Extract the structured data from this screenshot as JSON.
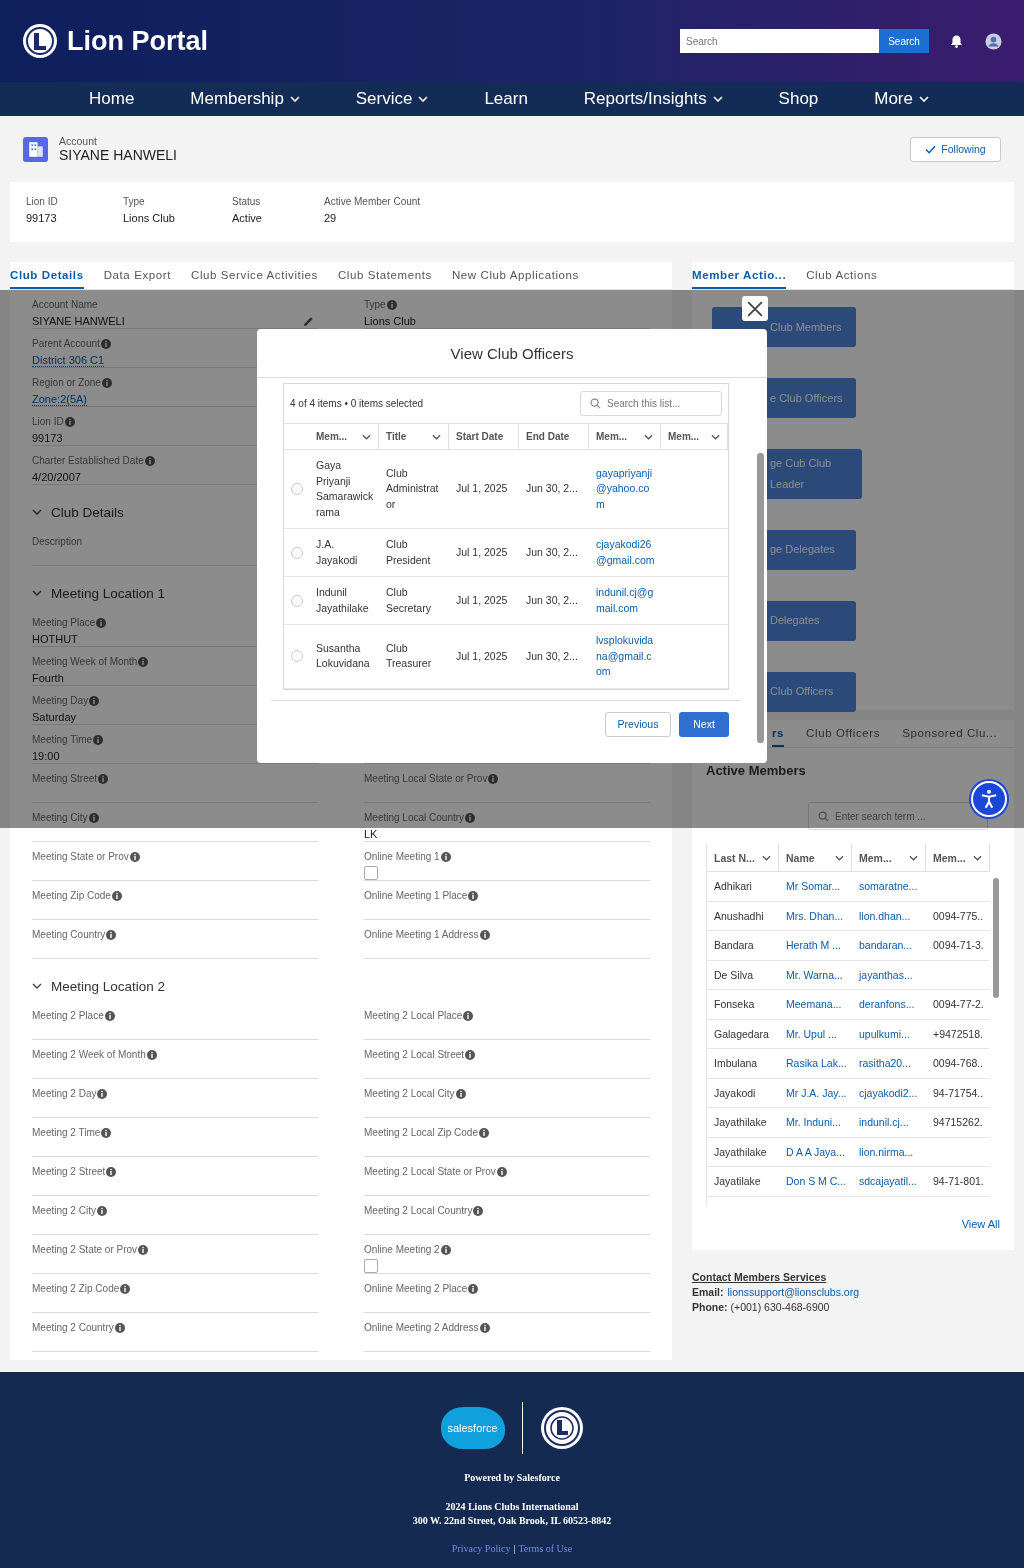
{
  "header": {
    "title": "Lion Portal",
    "search": {
      "placeholder": "Search",
      "button": "Search"
    }
  },
  "nav": [
    {
      "label": "Home",
      "menu": false
    },
    {
      "label": "Membership",
      "menu": true
    },
    {
      "label": "Service",
      "menu": true
    },
    {
      "label": "Learn",
      "menu": false
    },
    {
      "label": "Reports/Insights",
      "menu": true
    },
    {
      "label": "Shop",
      "menu": false
    },
    {
      "label": "More",
      "menu": true
    }
  ],
  "account": {
    "type": "Account",
    "name": "SIYANE HANWELI",
    "follow_button": "Following",
    "following": true
  },
  "highlights": [
    {
      "label": "Lion ID",
      "value": "99173"
    },
    {
      "label": "Type",
      "value": "Lions Club"
    },
    {
      "label": "Status",
      "value": "Active"
    },
    {
      "label": "Active Member Count",
      "value": "29"
    }
  ],
  "details": {
    "tabs": [
      {
        "label": "Club Details",
        "selected": true
      },
      {
        "label": "Data Export",
        "selected": false
      },
      {
        "label": "Club Service Activities",
        "selected": false
      },
      {
        "label": "Club Statements",
        "selected": false
      },
      {
        "label": "New Club Applications",
        "selected": false
      }
    ],
    "sections": [
      {
        "rows": [
          {
            "left": {
              "label": "Account Name",
              "info": false,
              "kind": "text",
              "value": "SIYANE HANWELI",
              "editable": true
            },
            "right": {
              "label": "Type",
              "info": true,
              "kind": "text",
              "value": "Lions Club"
            }
          },
          {
            "left": {
              "label": "Parent Account",
              "info": true,
              "kind": "link",
              "value": "District 306 C1"
            }
          },
          {
            "left": {
              "label": "Region or Zone",
              "info": true,
              "kind": "link",
              "value": "Zone:2(5A)"
            }
          },
          {
            "left": {
              "label": "Lion ID",
              "info": true,
              "kind": "text",
              "value": "99173"
            }
          },
          {
            "left": {
              "label": "Charter Established Date",
              "info": true,
              "kind": "text",
              "value": "4/20/2007"
            }
          }
        ]
      },
      {
        "title": "Club Details",
        "expanded": true,
        "rows": [
          {
            "left": {
              "label": "Description",
              "info": false,
              "kind": "text"
            }
          }
        ]
      },
      {
        "title": "Meeting Location 1",
        "expanded": true,
        "rows": [
          {
            "left": {
              "label": "Meeting Place",
              "info": true,
              "kind": "text",
              "value": "HOTHUT"
            }
          },
          {
            "left": {
              "label": "Meeting Week of Month",
              "info": true,
              "kind": "text",
              "value": "Fourth"
            }
          },
          {
            "left": {
              "label": "Meeting Day",
              "info": true,
              "kind": "text",
              "value": "Saturday"
            }
          },
          {
            "left": {
              "label": "Meeting Time",
              "info": true,
              "kind": "text",
              "value": "19:00"
            }
          },
          {
            "left": {
              "label": "Meeting Street",
              "info": true,
              "kind": "text"
            },
            "right": {
              "label": "Meeting Local State or Prov",
              "info": true,
              "kind": "text"
            }
          },
          {
            "left": {
              "label": "Meeting City",
              "info": true,
              "kind": "text"
            },
            "right": {
              "label": "Meeting Local Country",
              "info": true,
              "kind": "text",
              "value": "LK"
            }
          },
          {
            "left": {
              "label": "Meeting State or Prov",
              "info": true,
              "kind": "text"
            },
            "right": {
              "label": "Online Meeting 1",
              "info": true,
              "kind": "checkbox",
              "checked": false
            }
          },
          {
            "left": {
              "label": "Meeting Zip Code",
              "info": true,
              "kind": "text"
            },
            "right": {
              "label": "Online Meeting 1 Place",
              "info": true,
              "kind": "text"
            }
          },
          {
            "left": {
              "label": "Meeting Country",
              "info": true,
              "kind": "text"
            },
            "right": {
              "label": "Online Meeting 1 Address",
              "info": true,
              "kind": "text"
            }
          }
        ]
      },
      {
        "title": "Meeting Location 2",
        "expanded": true,
        "rows": [
          {
            "left": {
              "label": "Meeting 2 Place",
              "info": true,
              "kind": "text"
            },
            "right": {
              "label": "Meeting 2 Local Place",
              "info": true,
              "kind": "text"
            }
          },
          {
            "left": {
              "label": "Meeting 2 Week of Month",
              "info": true,
              "kind": "text"
            },
            "right": {
              "label": "Meeting 2 Local Street",
              "info": true,
              "kind": "text"
            }
          },
          {
            "left": {
              "label": "Meeting 2 Day",
              "info": true,
              "kind": "text"
            },
            "right": {
              "label": "Meeting 2 Local City",
              "info": true,
              "kind": "text"
            }
          },
          {
            "left": {
              "label": "Meeting 2 Time",
              "info": true,
              "kind": "text"
            },
            "right": {
              "label": "Meeting 2 Local Zip Code",
              "info": true,
              "kind": "text"
            }
          },
          {
            "left": {
              "label": "Meeting 2 Street",
              "info": true,
              "kind": "text"
            },
            "right": {
              "label": "Meeting 2 Local State or Prov",
              "info": true,
              "kind": "text"
            }
          },
          {
            "left": {
              "label": "Meeting 2 City",
              "info": true,
              "kind": "text"
            },
            "right": {
              "label": "Meeting 2 Local Country",
              "info": true,
              "kind": "text"
            }
          },
          {
            "left": {
              "label": "Meeting 2 State or Prov",
              "info": true,
              "kind": "text"
            },
            "right": {
              "label": "Online Meeting 2",
              "info": true,
              "kind": "checkbox",
              "checked": false
            }
          },
          {
            "left": {
              "label": "Meeting 2 Zip Code",
              "info": true,
              "kind": "text"
            },
            "right": {
              "label": "Online Meeting 2 Place",
              "info": true,
              "kind": "text"
            }
          },
          {
            "left": {
              "label": "Meeting 2 Country",
              "info": true,
              "kind": "text"
            },
            "right": {
              "label": "Online Meeting 2 Address",
              "info": true,
              "kind": "text"
            }
          }
        ]
      }
    ]
  },
  "actions": {
    "tabs": [
      {
        "label": "Member Actio...",
        "selected": true
      },
      {
        "label": "Club Actions",
        "selected": false
      }
    ],
    "buttons": [
      "Club Members",
      "e Club Officers",
      "ge Cub Club Leader",
      "ge Delegates",
      "Delegates",
      "Club Officers"
    ]
  },
  "members": {
    "tabs": [
      {
        "label": "rs",
        "selected": true
      },
      {
        "label": "Club Officers",
        "selected": false
      },
      {
        "label": "Sponsored Clu...",
        "selected": false
      }
    ],
    "title": "Active Members",
    "search": {
      "placeholder": "Enter search term ..."
    },
    "columns": [
      {
        "label": "Last N...",
        "kind": "text"
      },
      {
        "label": "Name",
        "kind": "link"
      },
      {
        "label": "Mem...",
        "kind": "link"
      },
      {
        "label": "Mem...",
        "kind": "text"
      }
    ],
    "rows": [
      [
        "Adhikari",
        "Mr Somar...",
        "somaratne..."
      ],
      [
        "Anushadhi",
        "Mrs. Dhan...",
        "lion.dhan...",
        "0094-775.."
      ],
      [
        "Bandara",
        "Herath M ...",
        "bandaran...",
        "0094-71-3."
      ],
      [
        "De Silva",
        "Mr. Warna...",
        "jayanthas..."
      ],
      [
        "Fonseka",
        "Meemana...",
        "deranfons...",
        "0094-77-2."
      ],
      [
        "Galagedara",
        "Mr. Upul ...",
        "upulkumi...",
        "+9472518."
      ],
      [
        "Imbulana",
        "Rasika Lak...",
        "rasitha20...",
        "0094-768.."
      ],
      [
        "Jayakodi",
        "Mr J.A. Jay...",
        "cjayakodi2...",
        "94-71754.."
      ],
      [
        "Jayathilake",
        "Mr. Induni...",
        "indunil.cj...",
        "94715262."
      ],
      [
        "Jayathilake",
        "D A A Jaya...",
        "lion.nirma..."
      ],
      [
        "Jayatilake",
        "Don S M C...",
        "sdcajayatil...",
        "94-71-801."
      ]
    ],
    "link": "View All"
  },
  "contact": {
    "heading": "Contact Members Services",
    "email_label": "Email:",
    "email": "lionssupport@lionsclubs.org",
    "phone_label": "Phone:",
    "phone": "(+001) 630-468-6900"
  },
  "modal": {
    "title": "View Club Officers",
    "summary": "4 of 4 items • 0 items selected",
    "search": {
      "placeholder": "Search this list..."
    },
    "columns": [
      {
        "label": "Mem...",
        "menu": true,
        "kind": "text"
      },
      {
        "label": "Title",
        "menu": true,
        "kind": "text"
      },
      {
        "label": "Start Date",
        "menu": false,
        "kind": "text"
      },
      {
        "label": "End Date",
        "menu": false,
        "kind": "text"
      },
      {
        "label": "Mem...",
        "menu": true,
        "kind": "link"
      },
      {
        "label": "Mem...",
        "menu": true
      }
    ],
    "rows": [
      {
        "selected": false,
        "cells": [
          "Gaya Priyanji Samarawickrama",
          "Club Administrator",
          "Jul 1, 2025",
          "Jun 30, 2...",
          "gayapriyanji@yahoo.com"
        ]
      },
      {
        "selected": false,
        "cells": [
          "J.A. Jayakodi",
          "Club President",
          "Jul 1, 2025",
          "Jun 30, 2...",
          "cjayakodi26@gmail.com"
        ]
      },
      {
        "selected": false,
        "cells": [
          "Indunil Jayathilake",
          "Club Secretary",
          "Jul 1, 2025",
          "Jun 30, 2...",
          "indunil.cj@gmail.com"
        ]
      },
      {
        "selected": false,
        "cells": [
          "Susantha Lokuvidana",
          "Club Treasurer",
          "Jul 1, 2025",
          "Jun 30, 2...",
          "lvsplokuvidana@gmail.com"
        ]
      }
    ],
    "previous": "Previous",
    "next": "Next"
  },
  "footer": {
    "logo_text": "salesforce",
    "powered": "Powered by Salesforce",
    "copyright": "2024 Lions Clubs International",
    "address": "300 W. 22nd Street, Oak Brook, IL 60523-8842",
    "links": [
      "Privacy Policy",
      "Terms of Use"
    ],
    "separator": "|"
  }
}
